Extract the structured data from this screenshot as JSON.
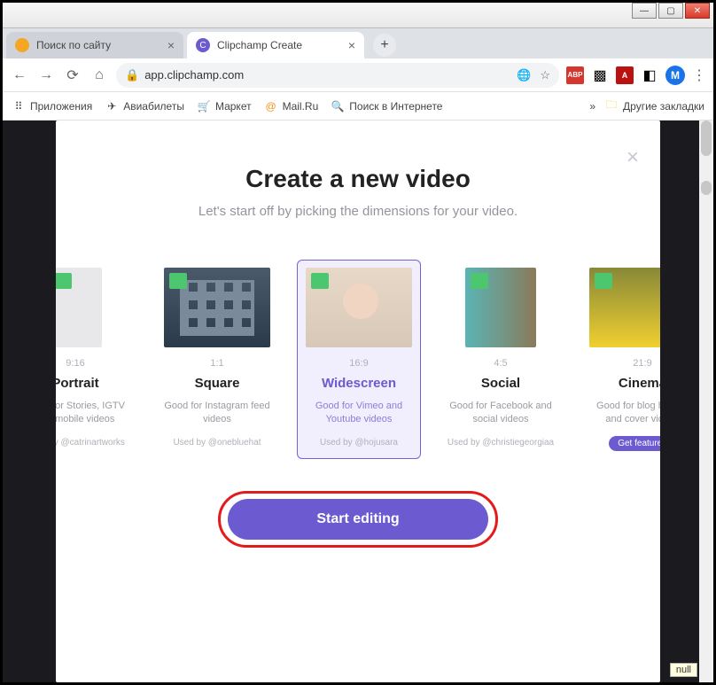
{
  "window": {
    "min": "—",
    "max": "▢",
    "close": "✕"
  },
  "tabs": {
    "t1_title": "Поиск по сайту",
    "t2_title": "Clipchamp Create",
    "close": "×",
    "add": "+"
  },
  "address": {
    "url": "app.clipchamp.com",
    "avatar": "M"
  },
  "bookmarks": {
    "apps": "Приложения",
    "avi": "Авиабилеты",
    "market": "Маркет",
    "mail": "Mail.Ru",
    "search": "Поиск в Интернете",
    "more": "»",
    "other": "Другие закладки"
  },
  "modal": {
    "close": "×",
    "title": "Create a new video",
    "subtitle": "Let's start off by picking the dimensions for your video.",
    "cta": "Start editing"
  },
  "cards": [
    {
      "ratio": "9:16",
      "title": "Portrait",
      "desc": "Good for Stories, IGTV and mobile videos",
      "used": "Used by @catrinartworks"
    },
    {
      "ratio": "1:1",
      "title": "Square",
      "desc": "Good for Instagram feed videos",
      "used": "Used by @onebluehat"
    },
    {
      "ratio": "16:9",
      "title": "Widescreen",
      "desc": "Good for Vimeo and Youtube videos",
      "used": "Used by @hojusara"
    },
    {
      "ratio": "4:5",
      "title": "Social",
      "desc": "Good for Facebook and social videos",
      "used": "Used by @christiegeorgiaa"
    },
    {
      "ratio": "21:9",
      "title": "Cinema",
      "desc": "Good for blog header and cover videos",
      "feat": "Get featured"
    }
  ],
  "null": "null"
}
